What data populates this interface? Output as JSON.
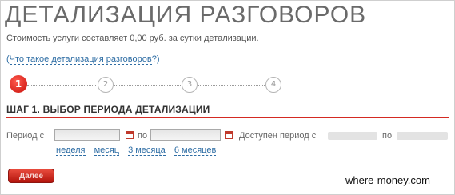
{
  "page": {
    "title": "ДЕТАЛИЗАЦИЯ РАЗГОВОРОВ",
    "cost_text": "Стоимость услуги составляет 0,00 руб. за сутки детализации.",
    "what_link_open": "(",
    "what_link": "Что такое детализация разговоров",
    "what_link_close": "?)"
  },
  "stepper": {
    "steps": [
      "1",
      "2",
      "3",
      "4"
    ],
    "active_step": 1,
    "accent_color": "#d42a22"
  },
  "step": {
    "heading": "ШАГ 1. ВЫБОР ПЕРИОДА ДЕТАЛИЗАЦИИ"
  },
  "period": {
    "label_from": "Период с",
    "from_value": "",
    "label_to": "по",
    "to_value": "",
    "available_label": "Доступен период с",
    "available_to_label": "по",
    "calendar_icon": "calendar-icon"
  },
  "quick_ranges": [
    "неделя",
    "месяц",
    "3 месяца",
    "6 месяцев"
  ],
  "actions": {
    "next_label": "Далее"
  },
  "watermark": "where-money.com"
}
